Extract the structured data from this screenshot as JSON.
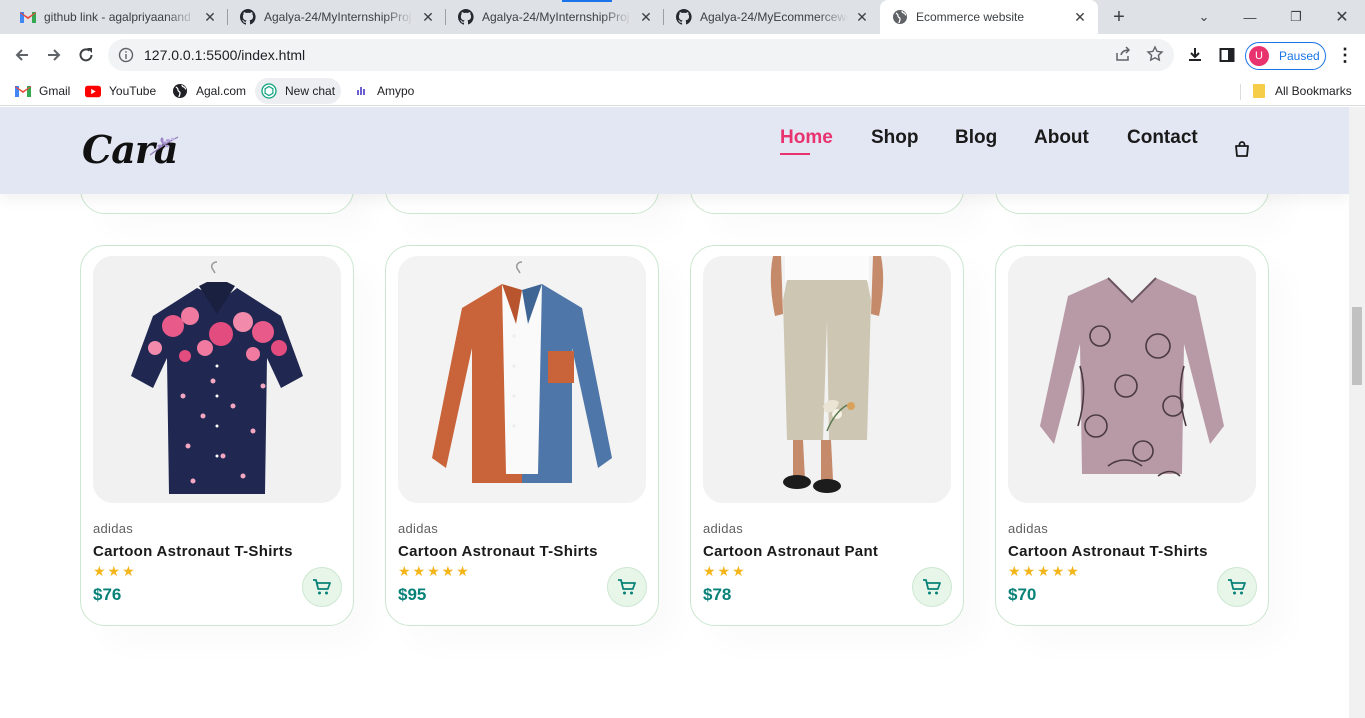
{
  "browser": {
    "tabs": [
      {
        "title": "github link - agalpriyaanand",
        "icon": "gmail-icon"
      },
      {
        "title": "Agalya-24/MyInternshipProj",
        "icon": "github-icon"
      },
      {
        "title": "Agalya-24/MyInternshipProj",
        "icon": "github-icon"
      },
      {
        "title": "Agalya-24/MyEcommercewe",
        "icon": "github-icon"
      },
      {
        "title": "Ecommerce website",
        "icon": "globe-icon",
        "active": true
      }
    ],
    "url": "127.0.0.1:5500/index.html",
    "profile_initial": "U",
    "profile_status": "Paused",
    "bookmarks": [
      {
        "label": "Gmail",
        "icon": "gmail-icon"
      },
      {
        "label": "YouTube",
        "icon": "youtube-icon"
      },
      {
        "label": "Agal.com",
        "icon": "globe-icon"
      },
      {
        "label": "New chat",
        "icon": "chatgpt-icon"
      },
      {
        "label": "Amypo",
        "icon": "amypo-icon"
      }
    ],
    "all_bookmarks": "All Bookmarks"
  },
  "site": {
    "logo": "Cara",
    "nav": [
      "Home",
      "Shop",
      "Blog",
      "About",
      "Contact"
    ],
    "active_nav": "Home",
    "accent_color": "#e8336e",
    "price_color": "#088178"
  },
  "products": [
    {
      "brand": "adidas",
      "name": "Cartoon Astronaut T-Shirts",
      "stars": "★★★",
      "rating": 3,
      "price": "$76",
      "image": "floral-shirt"
    },
    {
      "brand": "adidas",
      "name": "Cartoon Astronaut T-Shirts",
      "stars": "★★★★★",
      "rating": 5,
      "price": "$95",
      "image": "colorblock-jacket"
    },
    {
      "brand": "adidas",
      "name": "Cartoon Astronaut Pant",
      "stars": "★★★",
      "rating": 3,
      "price": "$78",
      "image": "linen-pants"
    },
    {
      "brand": "adidas",
      "name": "Cartoon Astronaut T-Shirts",
      "stars": "★★★★★",
      "rating": 5,
      "price": "$70",
      "image": "cat-print-top"
    }
  ]
}
